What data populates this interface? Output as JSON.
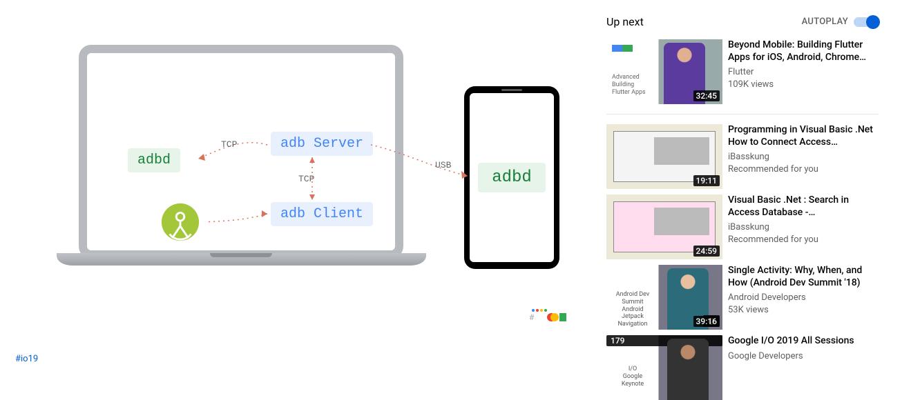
{
  "player": {
    "labels": {
      "adbd_laptop": "adbd",
      "adb_server": "adb Server",
      "adb_client": "adb Client",
      "adbd_phone": "adbd",
      "tcp1": "TCP",
      "tcp2": "TCP",
      "usb": "USB"
    }
  },
  "hashtag": "#io19",
  "sidebar": {
    "upnext_label": "Up next",
    "autoplay_label": "AUTOPLAY",
    "items": [
      {
        "title": "Beyond Mobile: Building Flutter Apps for iOS, Android, Chrome…",
        "channel": "Flutter",
        "views": "109K views",
        "duration": "32:45",
        "thumb_caption": "Advanced\nBuilding\nFlutter Apps"
      },
      {
        "title": "Programming in Visual Basic .Net How to Connect Access…",
        "channel": "iBasskung",
        "views": "Recommended for you",
        "duration": "19:11"
      },
      {
        "title": "Visual Basic .Net : Search in Access Database -…",
        "channel": "iBasskung",
        "views": "Recommended for you",
        "duration": "24:59"
      },
      {
        "title": "Single Activity: Why, When, and How (Android Dev Summit '18)",
        "channel": "Android Developers",
        "views": "53K views",
        "duration": "39:16",
        "thumb_caption": "Android Dev Summit\nAndroid\nJetpack\nNavigation"
      },
      {
        "title": "Google I/O 2019 All Sessions",
        "channel": "Google Developers",
        "badge": "179",
        "thumb_caption": "I/O\nGoogle\nKeynote"
      }
    ]
  }
}
